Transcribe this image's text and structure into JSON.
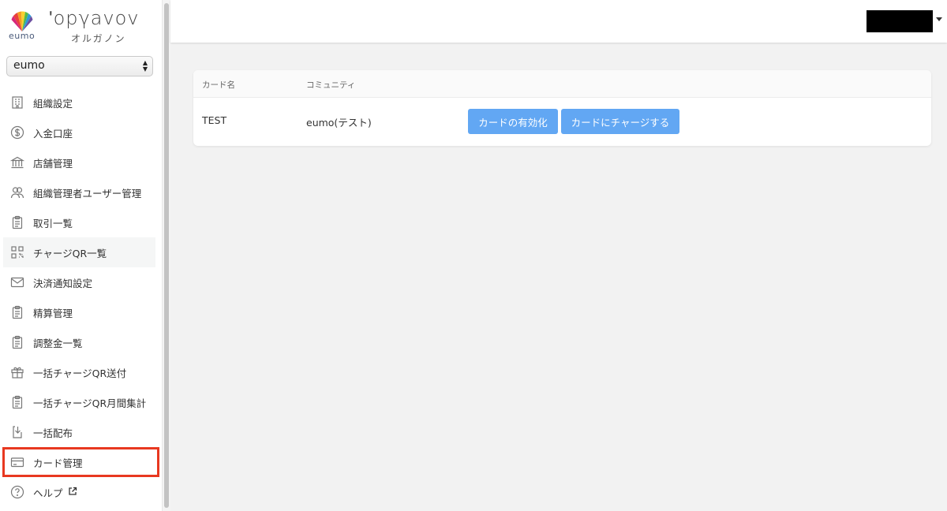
{
  "brand": {
    "eumo_label": "eumo",
    "logo_text": "ʹopγavov",
    "subtitle": "オルガノン"
  },
  "org_select": {
    "value": "eumo"
  },
  "sidebar": {
    "items": [
      {
        "label": "組織設定",
        "icon": "building-icon"
      },
      {
        "label": "入金口座",
        "icon": "dollar-circle-icon"
      },
      {
        "label": "店舗管理",
        "icon": "bank-icon"
      },
      {
        "label": "組織管理者ユーザー管理",
        "icon": "users-icon"
      },
      {
        "label": "取引一覧",
        "icon": "clipboard-icon"
      },
      {
        "label": "チャージQR一覧",
        "icon": "qr-code-icon"
      },
      {
        "label": "決済通知設定",
        "icon": "mail-icon"
      },
      {
        "label": "精算管理",
        "icon": "clipboard-icon"
      },
      {
        "label": "調整金一覧",
        "icon": "clipboard-icon"
      },
      {
        "label": "一括チャージQR送付",
        "icon": "gift-icon"
      },
      {
        "label": "一括チャージQR月間集計",
        "icon": "clipboard-icon"
      },
      {
        "label": "一括配布",
        "icon": "download-icon"
      },
      {
        "label": "カード管理",
        "icon": "credit-card-icon"
      },
      {
        "label": "ヘルプ",
        "icon": "help-circle-icon"
      }
    ]
  },
  "table": {
    "headers": [
      "カード名",
      "コミュニティ"
    ],
    "rows": [
      {
        "card_name": "TEST",
        "community": "eumo(テスト)",
        "activate_label": "カードの有効化",
        "charge_label": "カードにチャージする"
      }
    ]
  },
  "colors": {
    "button": "#62a7f3",
    "highlight_outline": "#e83820",
    "sidebar_bg": "#ffffff",
    "content_bg": "#f2f2f2"
  }
}
